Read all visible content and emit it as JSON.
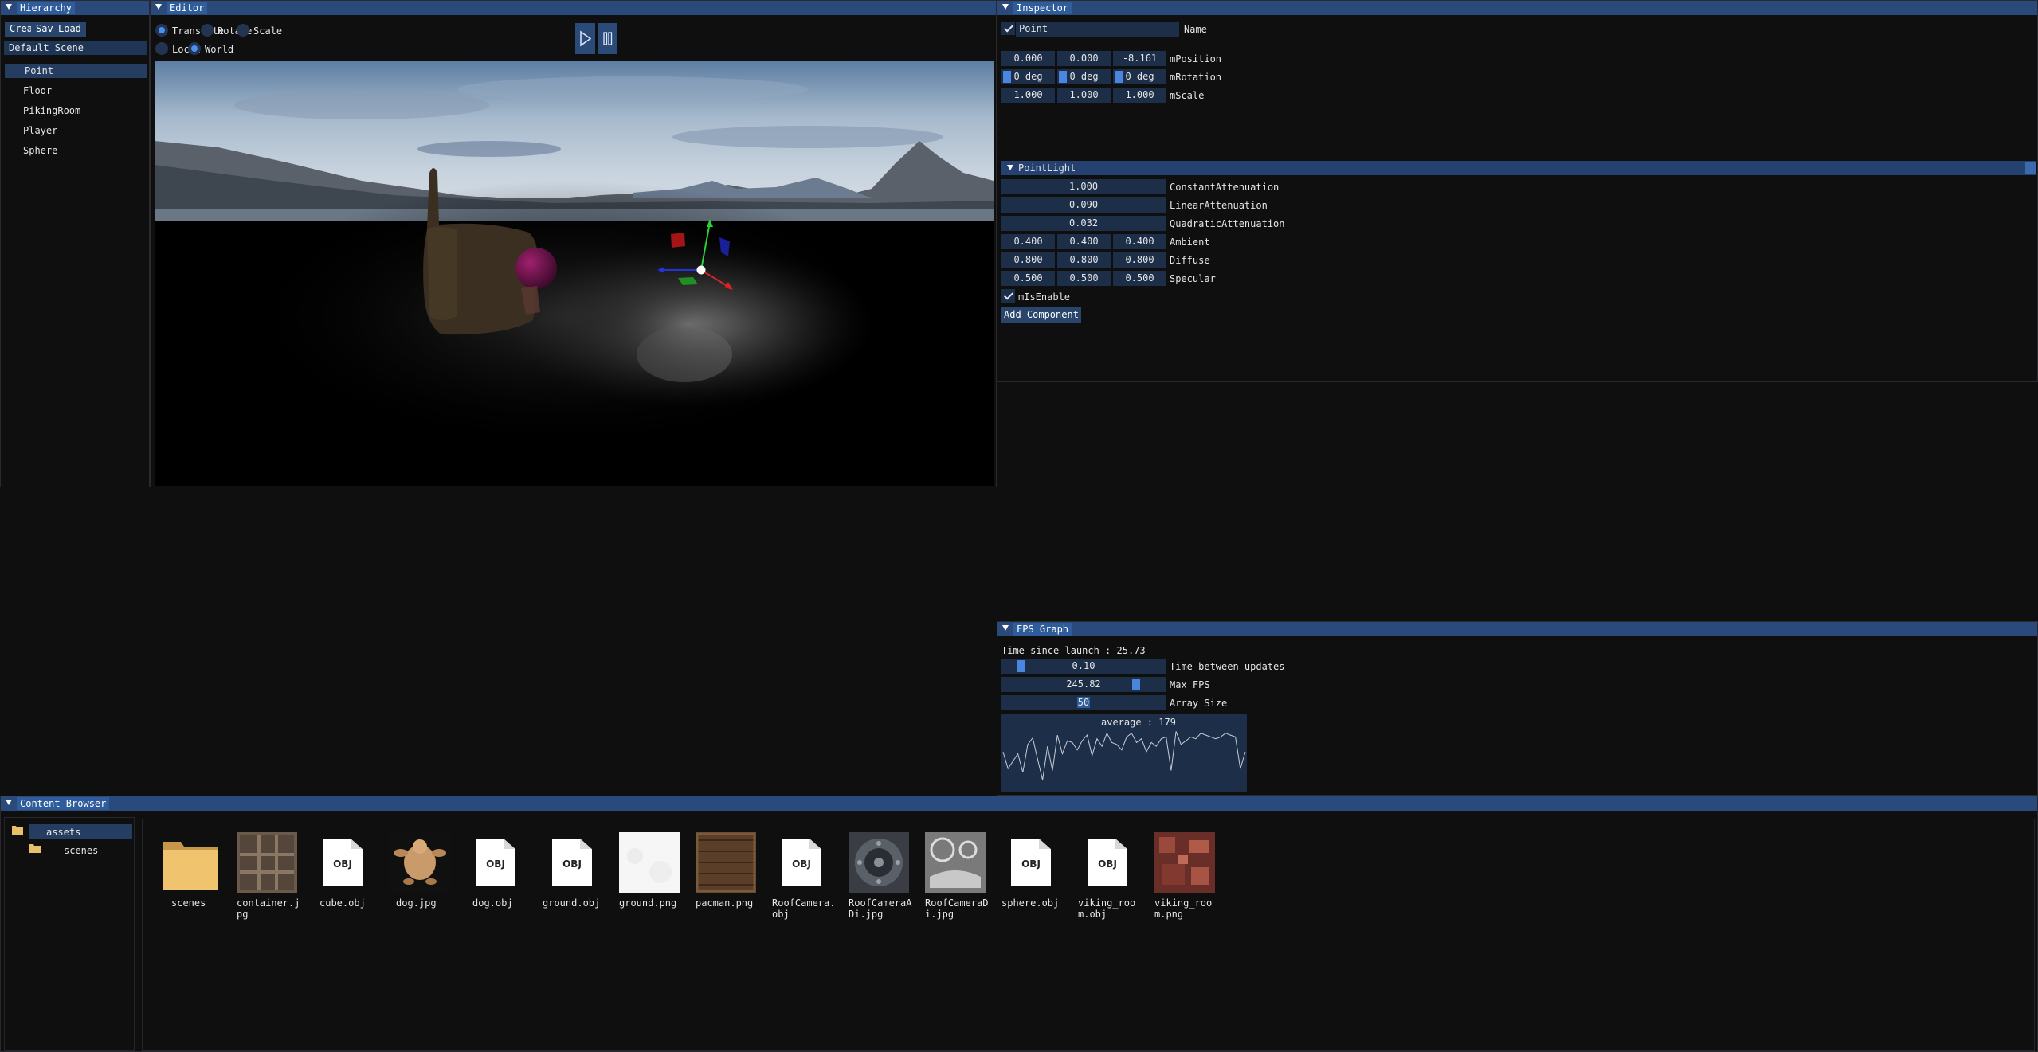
{
  "hierarchy": {
    "title": "Hierarchy",
    "create": "Create",
    "save": "Save",
    "load": "Load",
    "scene": "Default Scene",
    "items": [
      "Point",
      "Floor",
      "PikingRoom",
      "Player",
      "Sphere"
    ],
    "selected": "Point"
  },
  "editor": {
    "title": "Editor",
    "translate": "Translate",
    "rotate": "Rotate",
    "scale": "Scale",
    "local": "Local",
    "world": "World",
    "mode_selected": "Translate",
    "space_selected": "World"
  },
  "inspector": {
    "title": "Inspector",
    "name_value": "Point",
    "name_label": "Name",
    "position": [
      "0.000",
      "0.000",
      "-8.161"
    ],
    "position_label": "mPosition",
    "rotation": [
      "0 deg",
      "0 deg",
      "0 deg"
    ],
    "rotation_label": "mRotation",
    "scale": [
      "1.000",
      "1.000",
      "1.000"
    ],
    "scale_label": "mScale",
    "component_title": "PointLight",
    "constant": "1.000",
    "constant_label": "ConstantAttenuation",
    "linear": "0.090",
    "linear_label": "LinearAttenuation",
    "quadratic": "0.032",
    "quadratic_label": "QuadraticAttenuation",
    "ambient": [
      "0.400",
      "0.400",
      "0.400"
    ],
    "ambient_label": "Ambient",
    "diffuse": [
      "0.800",
      "0.800",
      "0.800"
    ],
    "diffuse_label": "Diffuse",
    "specular": [
      "0.500",
      "0.500",
      "0.500"
    ],
    "specular_label": "Specular",
    "enable_label": "mIsEnable",
    "add_component": "Add Component"
  },
  "fps": {
    "title": "FPS Graph",
    "time_since_launch": "Time since launch : 25.73",
    "update_value": "0.10",
    "update_label": "Time between updates",
    "max_fps_value": "245.82",
    "max_fps_label": "Max FPS",
    "array_size_value": "50",
    "array_size_label": "Array Size",
    "average": "average : 179",
    "samples": [
      170,
      152,
      160,
      168,
      148,
      178,
      185,
      162,
      140,
      176,
      150,
      188,
      168,
      182,
      180,
      172,
      182,
      188,
      166,
      184,
      176,
      190,
      180,
      178,
      172,
      186,
      190,
      180,
      184,
      170,
      180,
      176,
      184,
      186,
      150,
      192,
      178,
      182,
      186,
      184,
      190,
      188,
      186,
      184,
      186,
      190,
      188,
      186,
      152,
      170
    ]
  },
  "content": {
    "title": "Content Browser",
    "tree_assets": "assets",
    "tree_scenes": "scenes",
    "files": [
      {
        "name": "scenes",
        "kind": "folder"
      },
      {
        "name": "container.jpg",
        "kind": "container"
      },
      {
        "name": "cube.obj",
        "kind": "obj"
      },
      {
        "name": "dog.jpg",
        "kind": "dog"
      },
      {
        "name": "dog.obj",
        "kind": "obj"
      },
      {
        "name": "ground.obj",
        "kind": "obj"
      },
      {
        "name": "ground.png",
        "kind": "ground"
      },
      {
        "name": "pacman.png",
        "kind": "pacman"
      },
      {
        "name": "RoofCamera.obj",
        "kind": "obj"
      },
      {
        "name": "RoofCameraADi.jpg",
        "kind": "roofa"
      },
      {
        "name": "RoofCameraDi.jpg",
        "kind": "roofd"
      },
      {
        "name": "sphere.obj",
        "kind": "obj"
      },
      {
        "name": "viking_room.obj",
        "kind": "obj"
      },
      {
        "name": "viking_room.png",
        "kind": "viking"
      }
    ],
    "obj_glyph": "OBJ"
  },
  "colors": {
    "title_bar": "#294a7a",
    "accent": "#4a90f0",
    "field": "#1d2e48"
  }
}
